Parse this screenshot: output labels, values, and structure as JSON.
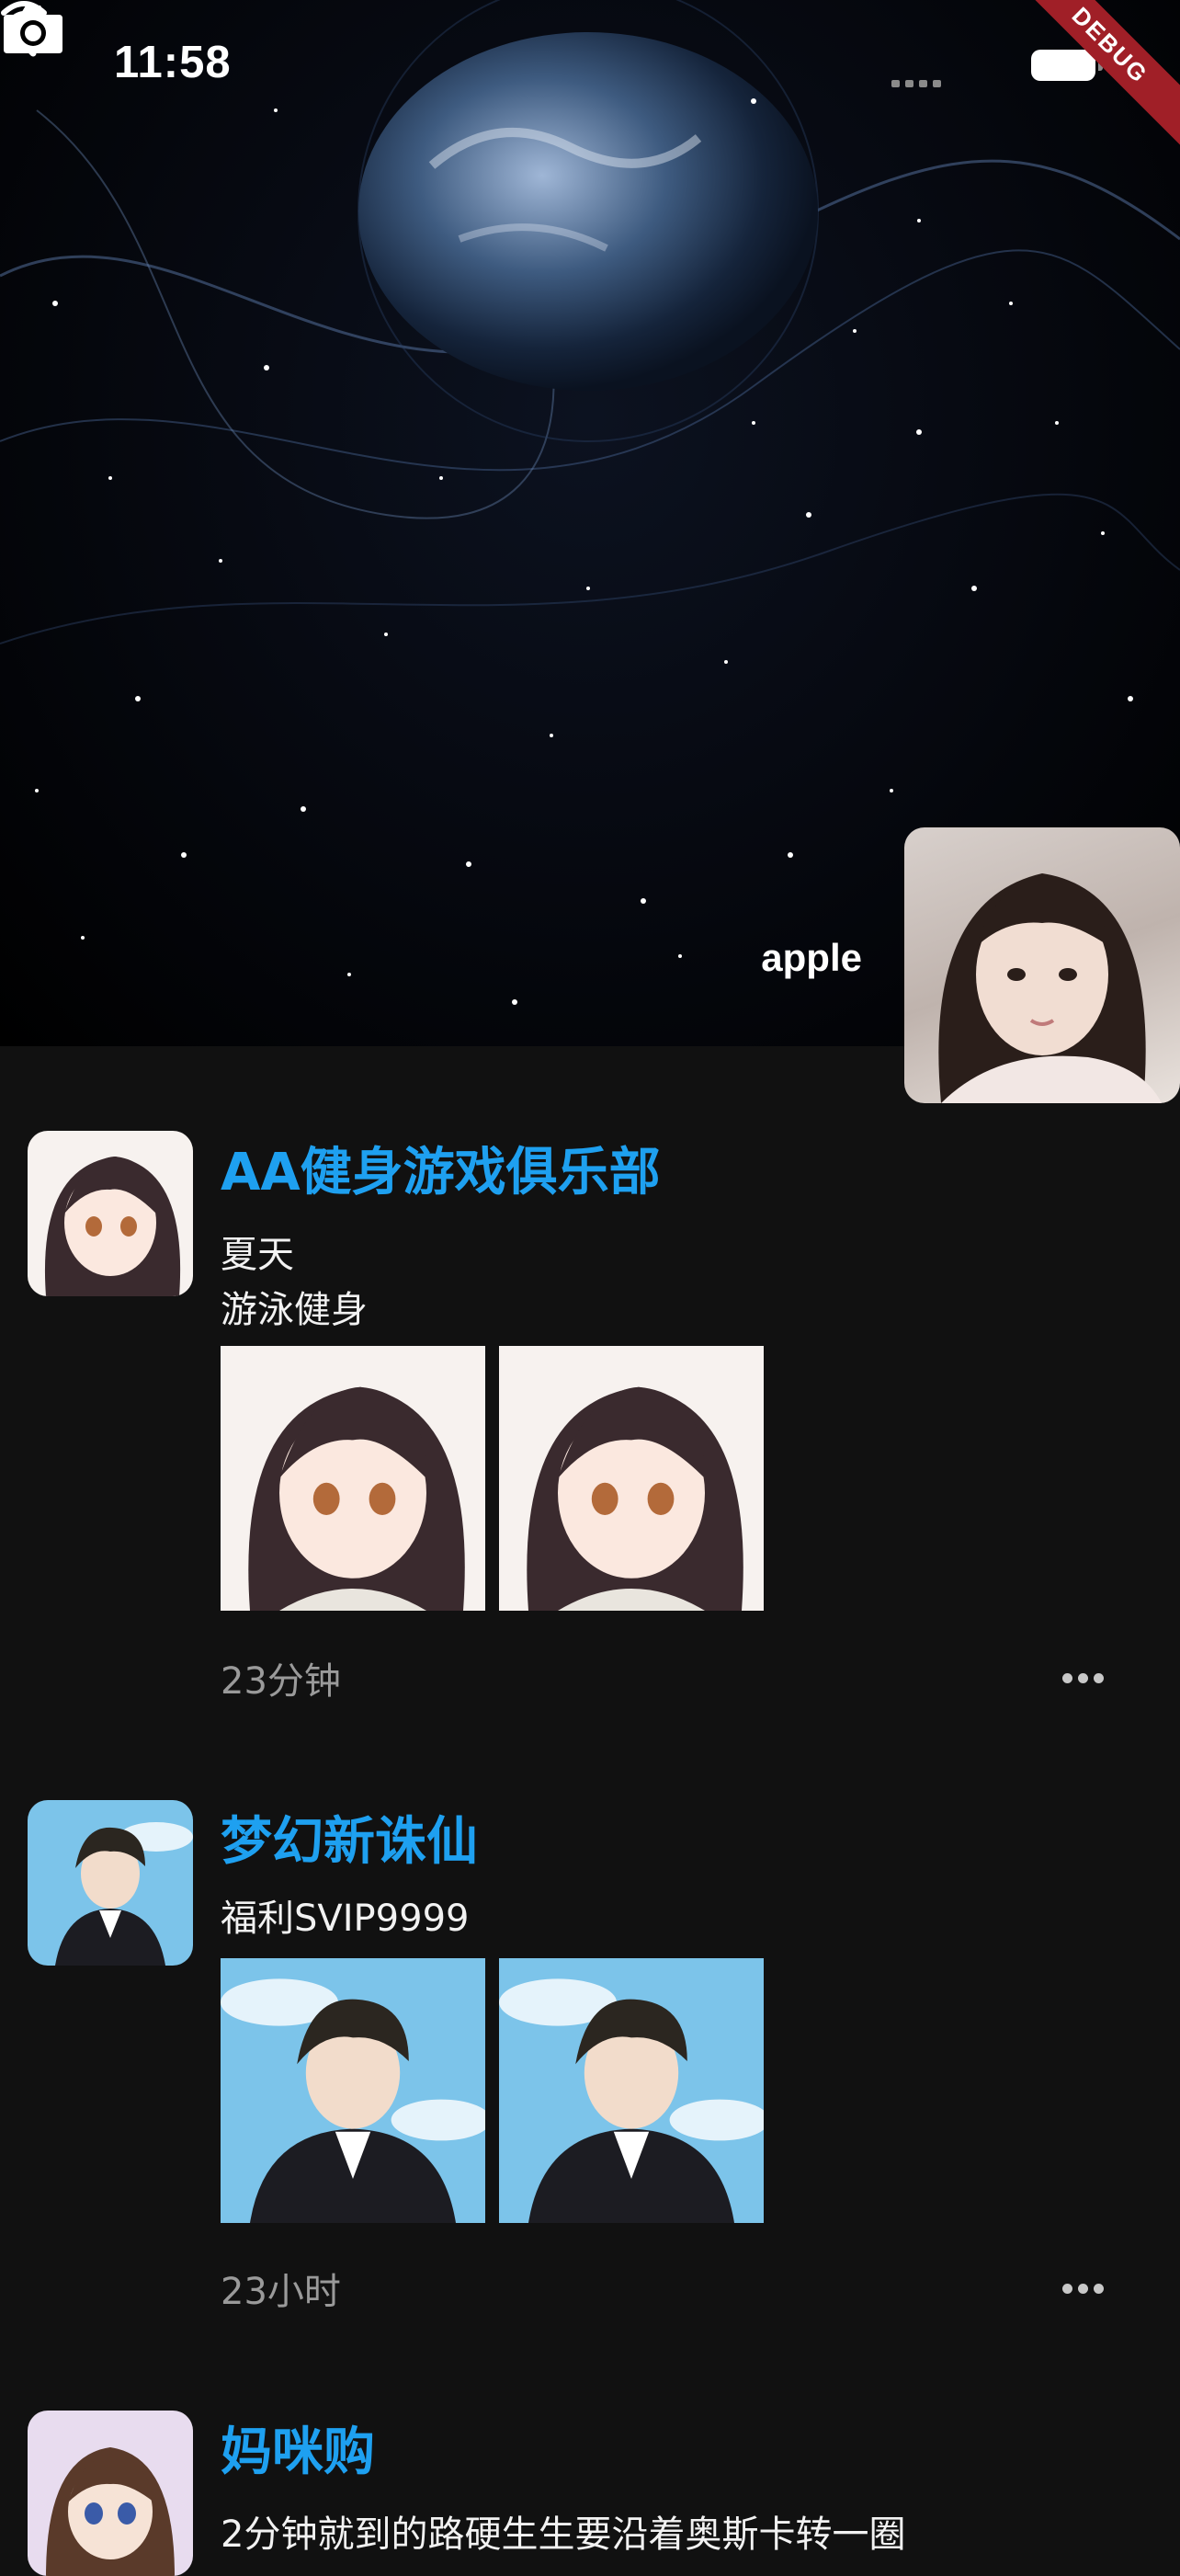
{
  "status_bar": {
    "time": "11:58",
    "debug_label": "DEBUG"
  },
  "header": {
    "username": "apple"
  },
  "posts": [
    {
      "title": "AA健身游戏俱乐部",
      "lines": [
        "夏天",
        "游泳健身"
      ],
      "time_ago": "23分钟"
    },
    {
      "title": "梦幻新诛仙",
      "lines": [
        "福利SVIP9999"
      ],
      "time_ago": "23小时"
    },
    {
      "title": "妈咪购",
      "lines": [
        "2分钟就到的路硬生生要沿着奥斯卡转一圈"
      ]
    }
  ],
  "icons": {
    "back": "chevron-left-icon",
    "camera": "camera-icon",
    "wifi": "wifi-icon",
    "battery": "battery-icon",
    "more": "more-horizontal-icon"
  },
  "colors": {
    "title_accent": "#1ea0f0",
    "background": "#111111",
    "debug_banner": "#a01f27"
  }
}
